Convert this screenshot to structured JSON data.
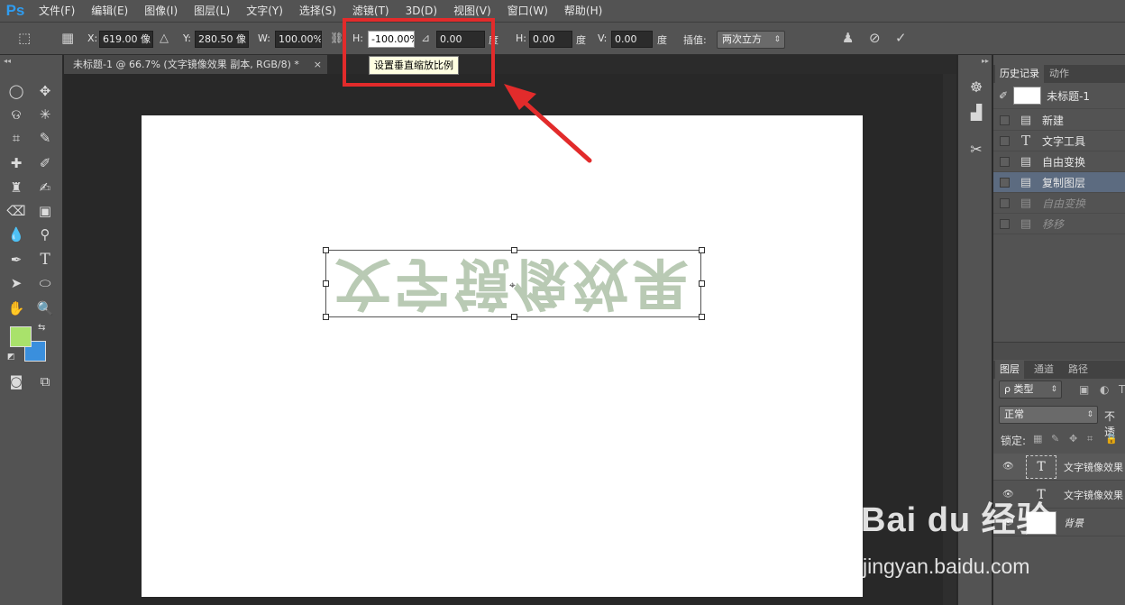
{
  "app": {
    "logo": "Ps"
  },
  "menu": [
    "文件(F)",
    "编辑(E)",
    "图像(I)",
    "图层(L)",
    "文字(Y)",
    "选择(S)",
    "滤镜(T)",
    "3D(D)",
    "视图(V)",
    "窗口(W)",
    "帮助(H)"
  ],
  "options": {
    "x_label": "X:",
    "x_value": "619.00 像",
    "y_label": "Y:",
    "y_value": "280.50 像",
    "w_label": "W:",
    "w_value": "100.00%",
    "h_label": "H:",
    "h_value": "-100.00%",
    "angle_value": "0.00",
    "angle_unit": "度",
    "hskew_label": "H:",
    "hskew_value": "0.00",
    "hskew_unit": "度",
    "vskew_label": "V:",
    "vskew_value": "0.00",
    "vskew_unit": "度",
    "interp_label": "插值:",
    "interp_value": "两次立方"
  },
  "tooltip": "设置垂直缩放比例",
  "document": {
    "tab_title": "未标题-1 @ 66.7% (文字镜像效果 副本, RGB/8) *",
    "close": "×"
  },
  "canvas_text": "文字镜像效果",
  "history": {
    "tabs": [
      "历史记录",
      "动作"
    ],
    "snapshot_label": "未标题-1",
    "items": [
      {
        "label": "新建",
        "icon": "doc-icon"
      },
      {
        "label": "文字工具",
        "icon": "type-icon"
      },
      {
        "label": "自由变换",
        "icon": "doc-icon"
      },
      {
        "label": "复制图层",
        "icon": "doc-icon"
      },
      {
        "label": "自由变换",
        "icon": "doc-icon"
      },
      {
        "label": "移移",
        "icon": "doc-icon"
      }
    ]
  },
  "layers": {
    "tabs": [
      "图层",
      "通道",
      "路径"
    ],
    "filter_label": "ρ 类型",
    "blend_mode": "正常",
    "opacity_label": "不透",
    "lock_label": "锁定:",
    "rows": [
      {
        "name": "文字镜像效果",
        "thumb": "T"
      },
      {
        "name": "文字镜像效果",
        "thumb": "T"
      },
      {
        "name": "背景",
        "thumb": ""
      }
    ]
  },
  "watermark": {
    "brand": "Bai du 经验",
    "url": "jingyan.baidu.com"
  },
  "colors": {
    "foreground": "#a9e26b",
    "background": "#3a8fdd",
    "highlight": "#e22b2b",
    "text_fill": "#b9cab4"
  }
}
